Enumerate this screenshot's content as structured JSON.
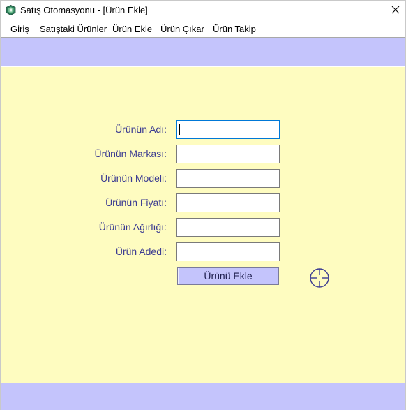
{
  "window": {
    "title": "Satış Otomasyonu - [Ürün Ekle]",
    "icon": "app-green-shield-icon",
    "close_icon": "close-icon"
  },
  "menu": {
    "items": [
      {
        "label": "Giriş"
      },
      {
        "label": "Satıştaki Ürünler"
      },
      {
        "label": "Ürün Ekle"
      },
      {
        "label": "Ürün Çıkar"
      },
      {
        "label": "Ürün Takip"
      }
    ]
  },
  "form": {
    "fields": [
      {
        "label": "Ürünün Adı:",
        "value": ""
      },
      {
        "label": "Ürünün Markası:",
        "value": ""
      },
      {
        "label": "Ürünün Modeli:",
        "value": ""
      },
      {
        "label": "Ürünün Fiyatı:",
        "value": ""
      },
      {
        "label": "Ürünün Ağırlığı:",
        "value": ""
      },
      {
        "label": "Ürün Adedi:",
        "value": ""
      }
    ],
    "submit_label": "Ürünü Ekle",
    "side_icon": "crosshair-icon"
  },
  "colors": {
    "band": "#c4c4fc",
    "content_bg": "#fefcc0",
    "label_text": "#3c3c92",
    "focus_border": "#0078d7"
  }
}
